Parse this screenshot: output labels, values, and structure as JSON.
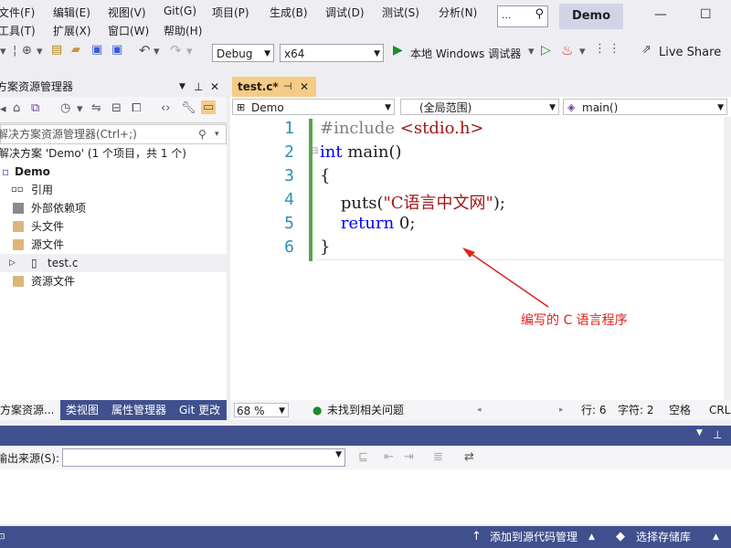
{
  "menu": {
    "row1": [
      "文件(F)",
      "编辑(E)",
      "视图(V)",
      "Git(G)",
      "项目(P)",
      "生成(B)",
      "调试(D)",
      "测试(S)",
      "分析(N)"
    ],
    "row2": [
      "工具(T)",
      "扩展(X)",
      "窗口(W)",
      "帮助(H)"
    ],
    "search_dots": "...",
    "title": "Demo"
  },
  "toolbar": {
    "config": "Debug",
    "platform": "x64",
    "run_label": "本地 Windows 调试器",
    "live_share": "Live Share"
  },
  "solution_explorer": {
    "title": "方案资源管理器",
    "search_placeholder": "解决方案资源管理器(Ctrl+;)",
    "tree": [
      {
        "label": "解决方案 'Demo' (1 个项目，共 1 个)",
        "level": 0
      },
      {
        "label": "Demo",
        "level": 0
      },
      {
        "label": "引用",
        "level": 1
      },
      {
        "label": "外部依赖项",
        "level": 1
      },
      {
        "label": "头文件",
        "level": 1
      },
      {
        "label": "源文件",
        "level": 1
      },
      {
        "label": "test.c",
        "level": 2
      },
      {
        "label": "资源文件",
        "level": 1
      }
    ],
    "tabs": [
      "方案资源...",
      "类视图",
      "属性管理器",
      "Git 更改"
    ]
  },
  "editor": {
    "tab_label": "test.c*",
    "nav": {
      "project": "Demo",
      "scope": "(全局范围)",
      "member": "main()"
    },
    "line_numbers": [
      "1",
      "2",
      "3",
      "4",
      "5",
      "6"
    ],
    "code": {
      "l1a": "#include ",
      "l1b": "<stdio.h>",
      "l2a": "int",
      "l2b": " main()",
      "l3": "{",
      "l4a": "    puts(",
      "l4b": "\"C语言中文网\"",
      "l4c": ");",
      "l5a": "    return",
      "l5b": " 0;",
      "l6": "}"
    },
    "annotation": "编写的 C 语言程序",
    "status": {
      "zoom": "68 %",
      "issues": "未找到相关问题",
      "line": "行: 6",
      "char": "字符: 2",
      "spacing": "空格",
      "eol": "CRL"
    }
  },
  "output": {
    "source_label": "输出来源(S):"
  },
  "statusbar": {
    "add_source_control": "添加到源代码管理",
    "select_repo": "选择存储库"
  },
  "colors": {
    "accent": "#40508f",
    "tab_active": "#f5cc84",
    "keyword": "#0000ff",
    "string": "#a31515",
    "annotation": "#e0231b",
    "line_number": "#2b91af"
  }
}
